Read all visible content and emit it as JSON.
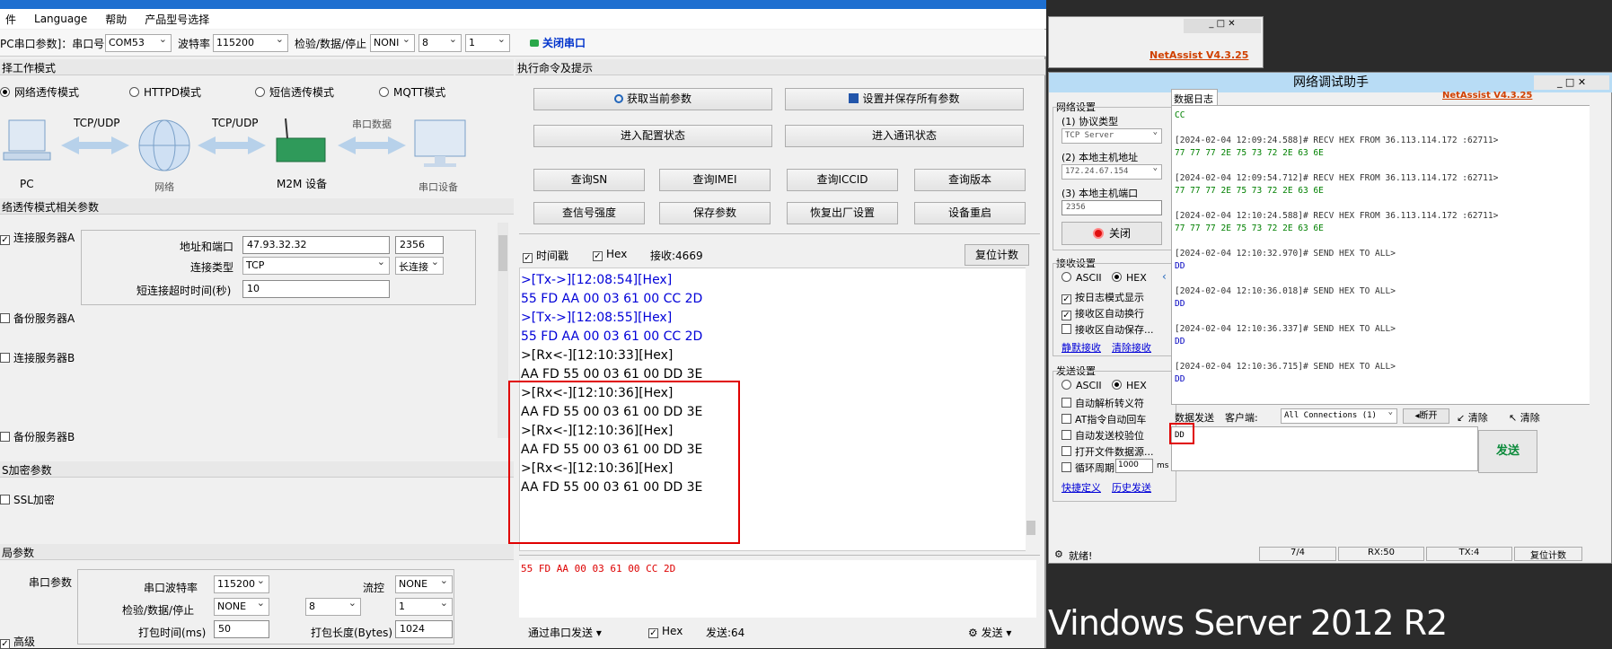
{
  "left_app": {
    "menu": [
      "件",
      "Language",
      "帮助",
      "产品型号选择"
    ],
    "toolbar": {
      "port_label": "PC串口参数]：串口号",
      "port_value": "COM53",
      "baud_label": "波特率",
      "baud_value": "115200",
      "parity_label": "检验/数据/停止",
      "parity_value": "NONI",
      "databits_value": "8",
      "stopbits_value": "1",
      "close_port_label": "关闭串口"
    },
    "work_mode": {
      "header": "择工作模式",
      "modes": [
        "网络透传模式",
        "HTTPD模式",
        "短信透传模式",
        "MQTT模式"
      ],
      "diagram": {
        "pc": "PC",
        "link1": "TCP/UDP",
        "network": "网络",
        "link2": "TCP/UDP",
        "m2m": "M2M 设备",
        "link3": "串口数据",
        "serial": "串口设备"
      }
    },
    "transparent_params": {
      "header": "络透传模式相关参数",
      "server_a_label": "连接服务器A",
      "address_port_label": "地址和端口",
      "address_value": "47.93.32.32",
      "port_value": "2356",
      "conn_type_label": "连接类型",
      "conn_type_value": "TCP",
      "conn_mode_value": "长连接",
      "short_timeout_label": "短连接超时时间(秒)",
      "short_timeout_value": "10",
      "backup_a_label": "备份服务器A",
      "server_b_label": "连接服务器B",
      "backup_b_label": "备份服务器B"
    },
    "ssl": {
      "header": "S加密参数",
      "ssl_label": "SSL加密"
    },
    "global": {
      "header": "局参数",
      "serial_params_label": "串口参数",
      "baud_label": "串口波特率",
      "baud_value": "115200",
      "flow_label": "流控",
      "flow_value": "NONE",
      "parity_label": "检验/数据/停止",
      "parity_value": "NONE",
      "databits_value": "8",
      "stopbits_value": "1",
      "pack_time_label": "打包时间(ms)",
      "pack_time_value": "50",
      "pack_len_label": "打包长度(Bytes)",
      "pack_len_value": "1024",
      "advanced_label": "高级"
    },
    "commands": {
      "header": "执行命令及提示",
      "get_params": "获取当前参数",
      "save_all": "设置并保存所有参数",
      "enter_config": "进入配置状态",
      "enter_comm": "进入通讯状态",
      "query_sn": "查询SN",
      "query_imei": "查询IMEI",
      "query_iccid": "查询ICCID",
      "query_version": "查询版本",
      "query_signal": "查信号强度",
      "save_params": "保存参数",
      "factory_reset": "恢复出厂设置",
      "restart": "设备重启"
    },
    "receive": {
      "timestamp_label": "时间戳",
      "hex_label": "Hex",
      "recv_count": "接收:4669",
      "reset_count": "复位计数",
      "lines": [
        {
          "text": ">[Tx->][12:08:54][Hex]",
          "color": "blue"
        },
        {
          "text": "55 FD AA 00 03 61 00 CC 2D",
          "color": "blue"
        },
        {
          "text": ">[Tx->][12:08:55][Hex]",
          "color": "blue"
        },
        {
          "text": "55 FD AA 00 03 61 00 CC 2D",
          "color": "blue"
        },
        {
          "text": ">[Rx<-][12:10:33][Hex]",
          "color": "dark"
        },
        {
          "text": "AA FD 55 00 03 61 00 DD 3E",
          "color": "dark"
        },
        {
          "text": ">[Rx<-][12:10:36][Hex]",
          "color": "dark"
        },
        {
          "text": "AA FD 55 00 03 61 00 DD 3E",
          "color": "dark"
        },
        {
          "text": ">[Rx<-][12:10:36][Hex]",
          "color": "dark"
        },
        {
          "text": "AA FD 55 00 03 61 00 DD 3E",
          "color": "dark"
        },
        {
          "text": ">[Rx<-][12:10:36][Hex]",
          "color": "dark"
        },
        {
          "text": "AA FD 55 00 03 61 00 DD 3E",
          "color": "dark"
        }
      ]
    },
    "send": {
      "text": "55 FD AA 00 03 61 00 CC 2D",
      "via_label": "通过串口发送",
      "hex_label": "Hex",
      "send_count": "发送:64",
      "send_button": "发送"
    }
  },
  "net_assist": {
    "title": "网络调试助手",
    "brand": "NetAssist V4.3.25",
    "net_settings": "网络设置",
    "protocol_label": "(1) 协议类型",
    "protocol_value": "TCP Server",
    "local_host_label": "(2) 本地主机地址",
    "local_host_value": "172.24.67.154",
    "local_port_label": "(3) 本地主机端口",
    "local_port_value": "2356",
    "close_button": "关闭",
    "recv_settings": "接收设置",
    "ascii": "ASCII",
    "hex": "HEX",
    "log_mode": "按日志模式显示",
    "auto_wrap": "接收区自动换行",
    "auto_save": "接收区自动保存...",
    "silent_recv": "静默接收",
    "clear_recv": "清除接收",
    "send_settings": "发送设置",
    "auto_escape": "自动解析转义符",
    "at_auto_return": "AT指令自动回车",
    "auto_checksum": "自动发送校验位",
    "open_file": "打开文件数据源...",
    "cycle_label": "循环周期",
    "cycle_value": "1000",
    "cycle_unit": "ms",
    "quick_define": "快捷定义",
    "history_send": "历史发送",
    "data_log_tab": "数据日志",
    "log_lines": [
      {
        "text": "CC",
        "c": "g"
      },
      {
        "text": "[2024-02-04 12:09:24.588]# RECV HEX FROM 36.113.114.172 :62711>",
        "c": "k"
      },
      {
        "text": "77 77 77 2E 75 73 72 2E 63 6E",
        "c": "g"
      },
      {
        "text": "[2024-02-04 12:09:54.712]# RECV HEX FROM 36.113.114.172 :62711>",
        "c": "k"
      },
      {
        "text": "77 77 77 2E 75 73 72 2E 63 6E",
        "c": "g"
      },
      {
        "text": "[2024-02-04 12:10:24.588]# RECV HEX FROM 36.113.114.172 :62711>",
        "c": "k"
      },
      {
        "text": "77 77 77 2E 75 73 72 2E 63 6E",
        "c": "g"
      },
      {
        "text": "[2024-02-04 12:10:32.970]# SEND HEX TO ALL>",
        "c": "k"
      },
      {
        "text": "DD",
        "c": "b"
      },
      {
        "text": "[2024-02-04 12:10:36.018]# SEND HEX TO ALL>",
        "c": "k"
      },
      {
        "text": "DD",
        "c": "b"
      },
      {
        "text": "[2024-02-04 12:10:36.337]# SEND HEX TO ALL>",
        "c": "k"
      },
      {
        "text": "DD",
        "c": "b"
      },
      {
        "text": "[2024-02-04 12:10:36.715]# SEND HEX TO ALL>",
        "c": "k"
      },
      {
        "text": "DD",
        "c": "b"
      }
    ],
    "data_send_tab": "数据发送",
    "client_label": "客户端:",
    "client_value": "All Connections (1)",
    "disconnect": "断开",
    "clear1": "清除",
    "clear2": "清除",
    "send_text": "DD",
    "send_button": "发送",
    "status_ready": "就绪!",
    "status_count": "7/4",
    "status_rx": "RX:50",
    "status_tx": "TX:4",
    "status_reset": "复位计数"
  },
  "desktop": {
    "os_label": "Vindows Server 2012 R2"
  },
  "colors": {
    "highlight_red": "#e00000",
    "accent_blue": "#1e6fd0"
  }
}
